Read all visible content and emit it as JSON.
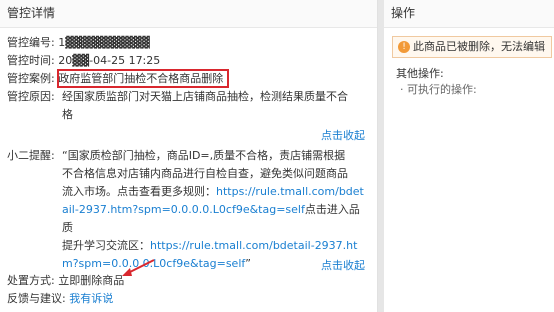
{
  "left": {
    "title": "管控详情",
    "code_label": "管控编号:",
    "code_value": "1▓▓▓▓▓▓▓▓▓▓",
    "time_label": "管控时间:",
    "time_value": "20▓▓-04-25 17:25",
    "case_label": "管控案例:",
    "case_value": "政府监管部门抽检不合格商品删除",
    "reason_label": "管控原因:",
    "reason_line1": "经国家质监部门对天猫上店铺商品抽检，检测结果质量不合",
    "reason_line2": "格",
    "collapse1": "点击收起",
    "tip_label": "小二提醒:",
    "tip_line1": "“国家质检部门抽检，商品ID=,质量不合格，责店铺需根据",
    "tip_line2": "不合格信息对店铺内商品进行自检自查，避免类似问题商品",
    "tip_line3": "流入市场。点击查看更多规则：",
    "tip_link1a": "https://rule.tmall.com/bdet",
    "tip_link1b": "ail-2937.htm?spm=0.0.0.0.L0cf9e&tag=self",
    "tip_mid": "点击进入品质",
    "tip_line6": "提升学习交流区：",
    "tip_link2a": "https://rule.tmall.com/bdetail-2937.ht",
    "tip_link2b": "m?spm=0.0.0.0.L0cf9e&tag=self",
    "tip_end": "”",
    "collapse2": "点击收起",
    "action_label": "处置方式:",
    "action_value": "立即删除商品",
    "feedback_label": "反馈与建议:",
    "feedback_link": "我有诉说"
  },
  "right": {
    "title": "操作",
    "notice_icon": "!",
    "notice_text": "此商品已被删除，无法编辑",
    "other_label": "其他操作:",
    "other_item": "· 可执行的操作:"
  },
  "colors": {
    "highlight": "#d9272e",
    "link": "#1a7fd1",
    "notice_icon": "#f29a38"
  }
}
